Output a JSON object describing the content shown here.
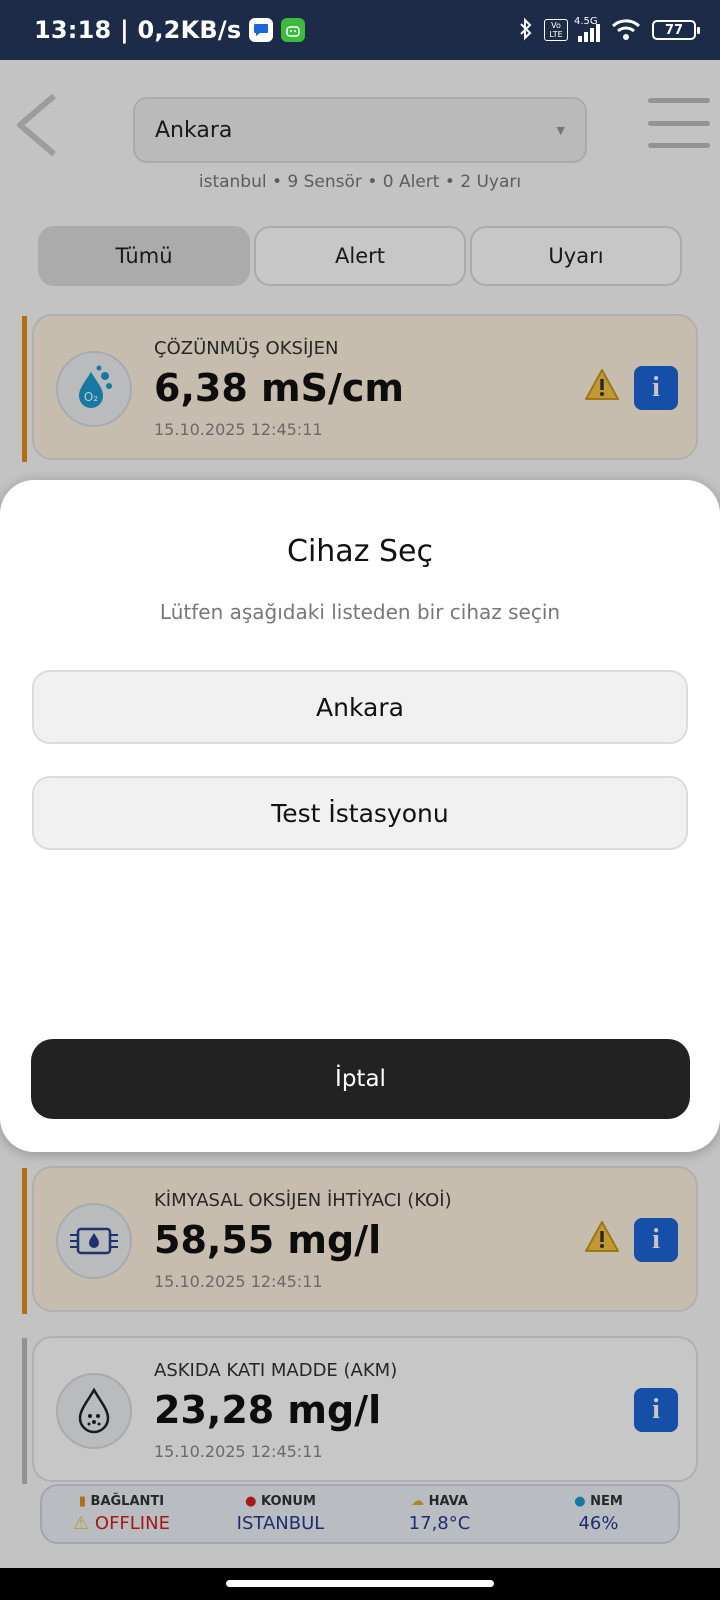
{
  "status_bar": {
    "time": "13:18 | 0,2KB/s",
    "network": "4.5G",
    "volte": "Vo LTE",
    "battery": "77",
    "icons": [
      "messenger-icon",
      "android-app-icon",
      "bluetooth-icon",
      "signal-icon",
      "wifi-icon",
      "battery-icon"
    ]
  },
  "header": {
    "selected_device": "Ankara",
    "summary": "istanbul • 9 Sensör • 0 Alert • 2 Uyarı"
  },
  "filters": {
    "tabs": [
      {
        "label": "Tümü",
        "active": true
      },
      {
        "label": "Alert",
        "active": false
      },
      {
        "label": "Uyarı",
        "active": false
      }
    ]
  },
  "sensors": [
    {
      "name": "ÇÖZÜNMÜŞ OKSİJEN",
      "value": "6,38 mS/cm",
      "timestamp": "15.10.2025 12:45:11",
      "status": "warning",
      "icon": "oxygen-drop-icon"
    },
    {
      "name": "KİMYASAL OKSİJEN İHTİYACI (KOİ)",
      "value": "58,55 mg/l",
      "timestamp": "15.10.2025 12:45:11",
      "status": "warning",
      "icon": "chemical-flow-icon"
    },
    {
      "name": "ASKIDA KATI MADDE (AKM)",
      "value": "23,28 mg/l",
      "timestamp": "15.10.2025 12:45:11",
      "status": "normal",
      "icon": "particle-drop-icon"
    }
  ],
  "modal": {
    "title": "Cihaz Seç",
    "subtitle": "Lütfen aşağıdaki listeden bir cihaz seçin",
    "options": [
      "Ankara",
      "Test İstasyonu"
    ],
    "cancel_label": "İptal"
  },
  "bottom_bar": {
    "items": [
      {
        "label": "BAĞLANTI",
        "value": "OFFLINE",
        "icon": "signal-bars-icon"
      },
      {
        "label": "KONUM",
        "value": "ISTANBUL",
        "icon": "location-pin-icon"
      },
      {
        "label": "HAVA",
        "value": "17,8°C",
        "icon": "weather-icon"
      },
      {
        "label": "NEM",
        "value": "46%",
        "icon": "water-drop-icon"
      }
    ]
  },
  "colors": {
    "status_bar": "#1b2b48",
    "warning_accent": "#e58e16",
    "info_button": "#1c66d8",
    "cancel_button": "#222222",
    "offline": "#d32121"
  }
}
